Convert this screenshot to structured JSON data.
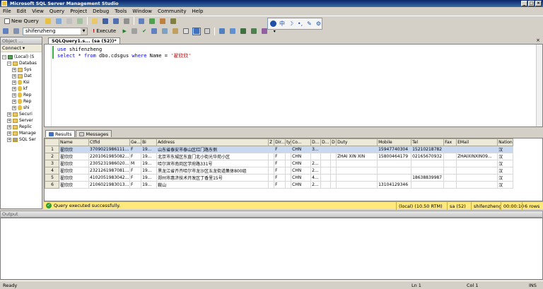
{
  "window": {
    "title": "Microsoft SQL Server Management Studio"
  },
  "menu": [
    "File",
    "Edit",
    "View",
    "Query",
    "Project",
    "Debug",
    "Tools",
    "Window",
    "Community",
    "Help"
  ],
  "toolbar1": {
    "new_query": "New Query"
  },
  "toolbar2": {
    "database": "shifenzheng",
    "execute": "Execute"
  },
  "floatbar": {
    "ime": "中"
  },
  "object_explorer": {
    "title": "Object ...",
    "connect": "Connect",
    "nodes": [
      {
        "label": "(Local) (S",
        "indent": 0,
        "icon": "server"
      },
      {
        "label": "Databas",
        "indent": 1,
        "icon": "folder"
      },
      {
        "label": "Sys",
        "indent": 2,
        "icon": "folder"
      },
      {
        "label": "Dat",
        "indent": 2,
        "icon": "folder"
      },
      {
        "label": "Ksi",
        "indent": 2,
        "icon": "db"
      },
      {
        "label": "kf",
        "indent": 2,
        "icon": "db"
      },
      {
        "label": "Rep",
        "indent": 2,
        "icon": "db"
      },
      {
        "label": "Rep",
        "indent": 2,
        "icon": "db"
      },
      {
        "label": "shi",
        "indent": 2,
        "icon": "db"
      },
      {
        "label": "Securi",
        "indent": 1,
        "icon": "folder"
      },
      {
        "label": "Server",
        "indent": 1,
        "icon": "folder"
      },
      {
        "label": "Replic",
        "indent": 1,
        "icon": "folder"
      },
      {
        "label": "Manage",
        "indent": 1,
        "icon": "folder"
      },
      {
        "label": "SQL Ser",
        "indent": 1,
        "icon": "agent"
      }
    ]
  },
  "editor": {
    "tab": "SQLQuery1.s... (sa (52))*",
    "line1_kw": "use",
    "line1_rest": " shifenzheng",
    "line2_kw1": "select",
    "line2_mid1": " * ",
    "line2_kw2": "from",
    "line2_mid2": " dbo.cdsgus ",
    "line2_kw3": "where",
    "line2_mid3": " Name = ",
    "line2_str": "'翟欣欣'"
  },
  "results": {
    "tab_results": "Results",
    "tab_messages": "Messages",
    "columns": [
      "Name",
      "CtfId",
      "Ge...",
      "Bi",
      "Address",
      "Z",
      "Dir...",
      "ty",
      "Co...",
      "D...",
      "D...",
      "D",
      "Duty",
      "Mobile",
      "Tel",
      "Fax",
      "EMail",
      "Nation"
    ],
    "rows": [
      [
        "翟欣欣",
        "3709021986111...",
        "F",
        "19...",
        "山东省泰安市泰山区红门路东侧",
        "",
        "F",
        "",
        "CHN",
        "3...",
        "",
        "",
        "",
        "15947740304",
        "15210218782",
        "",
        "",
        "汉"
      ],
      [
        "翟欣欣",
        "2201061985082...",
        "F",
        "19...",
        "北京市东城区东直门北小街光华苑小区",
        "",
        "F",
        "",
        "CHN",
        "",
        "",
        "",
        "ZHAI XIN XIN",
        "15800464179",
        "02165670932",
        "",
        "ZHAIXINXIN09...",
        "汉"
      ],
      [
        "翟欣欣",
        "2305231986020...",
        "M",
        "19...",
        "哈尔滨市南岗区学府路331号",
        "",
        "F",
        "",
        "CHN",
        "2...",
        "",
        "",
        "",
        "",
        "",
        "",
        "",
        "汉"
      ],
      [
        "翟欣欣",
        "2321261987081...",
        "F",
        "19...",
        "黑龙江省齐齐哈尔市龙沙区五龙街道集体800组",
        "",
        "F",
        "",
        "CHN",
        "2...",
        "",
        "",
        "",
        "",
        "",
        "",
        "",
        "汉"
      ],
      [
        "翟欣欣",
        "4102051983042...",
        "F",
        "19...",
        "郑州市惠济技术开发区丁香里15号",
        "",
        "F",
        "",
        "CHN",
        "4...",
        "",
        "",
        "",
        "",
        "18638839987",
        "",
        "",
        "汉"
      ],
      [
        "翟欣欣",
        "2106021983013...",
        "F",
        "19...",
        "鞍山",
        "",
        "F",
        "",
        "CHN",
        "2...",
        "",
        "",
        "",
        "13104129346",
        "",
        "",
        "",
        "汉"
      ]
    ]
  },
  "query_status": {
    "message": "Query executed successfully.",
    "server": "(local) (10.50 RTM)",
    "login": "sa (52)",
    "database": "shifenzheng",
    "time": "00:00:10",
    "rows": "6 rows"
  },
  "output": {
    "title": "Output"
  },
  "statusbar": {
    "ready": "Ready",
    "ln": "Ln 1",
    "col": "Col 1",
    "ins": "INS"
  }
}
